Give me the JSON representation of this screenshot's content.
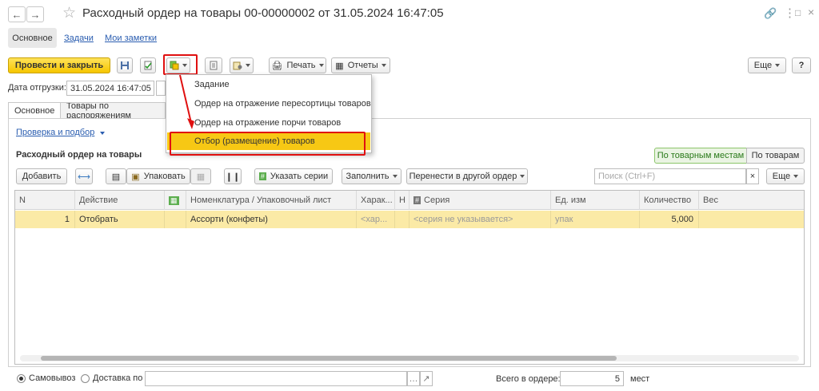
{
  "window": {
    "title": "Расходный ордер на товары 00-00000002 от 31.05.2024 16:47:05",
    "back_icon": "arrow-left-icon",
    "forward_icon": "arrow-right-icon"
  },
  "nav_tabs": [
    {
      "label": "Основное",
      "active": true
    },
    {
      "label": "Задачи",
      "active": false
    },
    {
      "label": "Мои заметки",
      "active": false
    }
  ],
  "toolbar": {
    "post_close_label": "Провести и закрыть",
    "print_label": "Печать",
    "reports_label": "Отчеты",
    "more_label": "Еще",
    "help_label": "?"
  },
  "shipment": {
    "label": "Дата отгрузки:",
    "value": "31.05.2024 16:47:05"
  },
  "sub_tabs": [
    {
      "label": "Основное"
    },
    {
      "label": "Товары по распоряжениям"
    }
  ],
  "dropdown_menu": {
    "items": [
      {
        "label": "Задание",
        "selected": false
      },
      {
        "label": "Ордер на отражение пересортицы товаров",
        "selected": false
      },
      {
        "label": "Ордер на отражение порчи товаров",
        "selected": false
      },
      {
        "label": "Отбор (размещение) товаров",
        "selected": true
      }
    ]
  },
  "check_link": "Проверка и подбор",
  "section_title": "Расходный ордер на товары",
  "view_toggle": {
    "by_places": "По товарным местам",
    "by_goods": "По товарам",
    "active": "by_places"
  },
  "table_toolbar": {
    "add_label": "Добавить",
    "pack_label": "Упаковать",
    "series_label": "Указать серии",
    "fill_label": "Заполнить",
    "move_label": "Перенести в другой ордер",
    "search_placeholder": "Поиск (Ctrl+F)",
    "clear_label": "×",
    "more_label": "Еще"
  },
  "table": {
    "columns": [
      "N",
      "Действие",
      "",
      "Номенклатура / Упаковочный лист",
      "Харак...",
      "Н",
      "Серия",
      "Ед. изм",
      "Количество",
      "Вес"
    ],
    "rows": [
      {
        "n": "1",
        "action": "Отобрать",
        "item": "Ассорти (конфеты)",
        "characteristic": "<хар...",
        "series": "<серия не указывается>",
        "unit": "упак",
        "quantity": "5,000",
        "weight": ""
      }
    ]
  },
  "footer": {
    "pickup_label": "Самовывоз",
    "delivery_label": "Доставка по",
    "delivery_value": "",
    "total_label": "Всего в ордере:",
    "total_value": "5",
    "unit_label": "мест"
  },
  "colors": {
    "accent": "#f6c600",
    "selected_row": "#fbeaa6",
    "menu_highlight": "#f7c814",
    "annotation_red": "#e01010",
    "link": "#2a5db0"
  }
}
